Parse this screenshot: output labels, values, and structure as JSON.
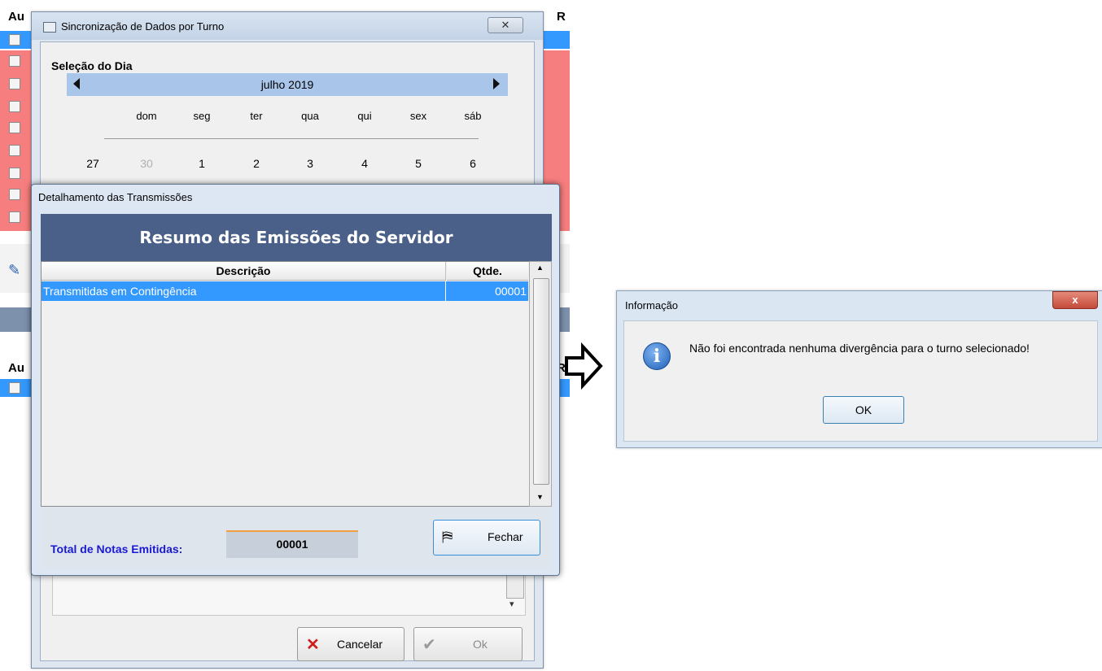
{
  "background_grid": {
    "col_header_top": "Au",
    "col_header_right": "R",
    "col_header_lower": "Au",
    "col_header_lower_right": "R"
  },
  "sync_window": {
    "title": "Sincronização de Dados por Turno",
    "close_glyph": "✕",
    "section_label": "Seleção do Dia",
    "calendar": {
      "month_label": "julho 2019",
      "weekdays": [
        "dom",
        "seg",
        "ter",
        "qua",
        "qui",
        "sex",
        "sáb"
      ],
      "week_number": "27",
      "days": [
        "30",
        "1",
        "2",
        "3",
        "4",
        "5",
        "6"
      ]
    },
    "cancel_label": "Cancelar",
    "ok_label": "Ok"
  },
  "detail_dialog": {
    "title": "Detalhamento das Transmissões",
    "banner": "Resumo das Emissões do Servidor",
    "columns": {
      "description": "Descrição",
      "qty": "Qtde."
    },
    "rows": [
      {
        "description": "Transmitidas em Contingência",
        "qty": "00001"
      }
    ],
    "total_label": "Total de Notas Emitidas:",
    "total_value": "00001",
    "close_label": "Fechar"
  },
  "info_dialog": {
    "title": "Informação",
    "close_glyph": "x",
    "message": "Não foi encontrada nenhuma divergência para o turno selecionado!",
    "ok_label": "OK",
    "icon_glyph": "i"
  },
  "colors": {
    "row_red": "#f77e7e",
    "row_blue": "#3399ff",
    "banner": "#4a6088",
    "calendar_header": "#a9c6ea",
    "total_label": "#1a1ad2"
  }
}
